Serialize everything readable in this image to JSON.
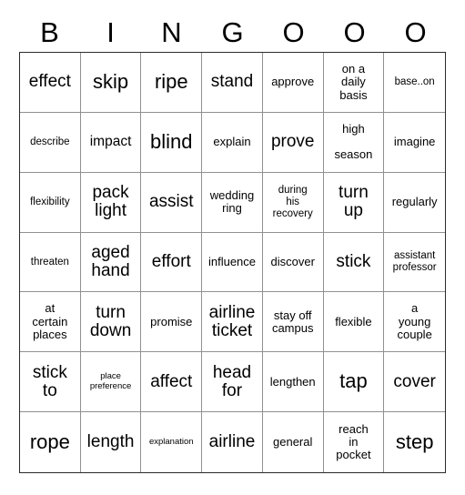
{
  "card": {
    "title_letters": [
      "B",
      "I",
      "N",
      "G",
      "O",
      "O",
      "O"
    ],
    "columns": 7,
    "rows": 7,
    "colors": {
      "background": "#ffffff",
      "text": "#000000",
      "outer_border": "#2b2b2b",
      "inner_border": "#909090"
    },
    "cells": [
      [
        {
          "text": "effect",
          "size": "xl"
        },
        {
          "text": "skip",
          "size": "xxl"
        },
        {
          "text": "ripe",
          "size": "xxl"
        },
        {
          "text": "stand",
          "size": "xl"
        },
        {
          "text": "approve",
          "size": "md"
        },
        {
          "text": "on a\ndaily\nbasis",
          "size": "md"
        },
        {
          "text": "base..on",
          "size": "sm"
        }
      ],
      [
        {
          "text": "describe",
          "size": "sm"
        },
        {
          "text": "impact",
          "size": "lg"
        },
        {
          "text": "blind",
          "size": "xxl"
        },
        {
          "text": "explain",
          "size": "md"
        },
        {
          "text": "prove",
          "size": "xl"
        },
        {
          "text": "high\n\nseason",
          "size": "gap"
        },
        {
          "text": "imagine",
          "size": "md"
        }
      ],
      [
        {
          "text": "flexibility",
          "size": "sm"
        },
        {
          "text": "pack\nlight",
          "size": "xl"
        },
        {
          "text": "assist",
          "size": "xl"
        },
        {
          "text": "wedding\nring",
          "size": "md"
        },
        {
          "text": "during\nhis\nrecovery",
          "size": "sm"
        },
        {
          "text": "turn\nup",
          "size": "xl"
        },
        {
          "text": "regularly",
          "size": "md"
        }
      ],
      [
        {
          "text": "threaten",
          "size": "sm"
        },
        {
          "text": "aged\nhand",
          "size": "xl"
        },
        {
          "text": "effort",
          "size": "xl"
        },
        {
          "text": "influence",
          "size": "md"
        },
        {
          "text": "discover",
          "size": "md"
        },
        {
          "text": "stick",
          "size": "xl"
        },
        {
          "text": "assistant\nprofessor",
          "size": "sm"
        }
      ],
      [
        {
          "text": "at\ncertain\nplaces",
          "size": "md"
        },
        {
          "text": "turn\ndown",
          "size": "xl"
        },
        {
          "text": "promise",
          "size": "md"
        },
        {
          "text": "airline\nticket",
          "size": "xl"
        },
        {
          "text": "stay off\ncampus",
          "size": "md"
        },
        {
          "text": "flexible",
          "size": "md"
        },
        {
          "text": "a\nyoung\ncouple",
          "size": "md"
        }
      ],
      [
        {
          "text": "stick\nto",
          "size": "xl"
        },
        {
          "text": "place\npreference",
          "size": "xs"
        },
        {
          "text": "affect",
          "size": "xl"
        },
        {
          "text": "head\nfor",
          "size": "xl"
        },
        {
          "text": "lengthen",
          "size": "md"
        },
        {
          "text": "tap",
          "size": "xxl"
        },
        {
          "text": "cover",
          "size": "xl"
        }
      ],
      [
        {
          "text": "rope",
          "size": "xxl"
        },
        {
          "text": "length",
          "size": "xl"
        },
        {
          "text": "explanation",
          "size": "xs"
        },
        {
          "text": "airline",
          "size": "xl"
        },
        {
          "text": "general",
          "size": "md"
        },
        {
          "text": "reach\nin\npocket",
          "size": "md"
        },
        {
          "text": "step",
          "size": "xxl"
        }
      ]
    ]
  }
}
